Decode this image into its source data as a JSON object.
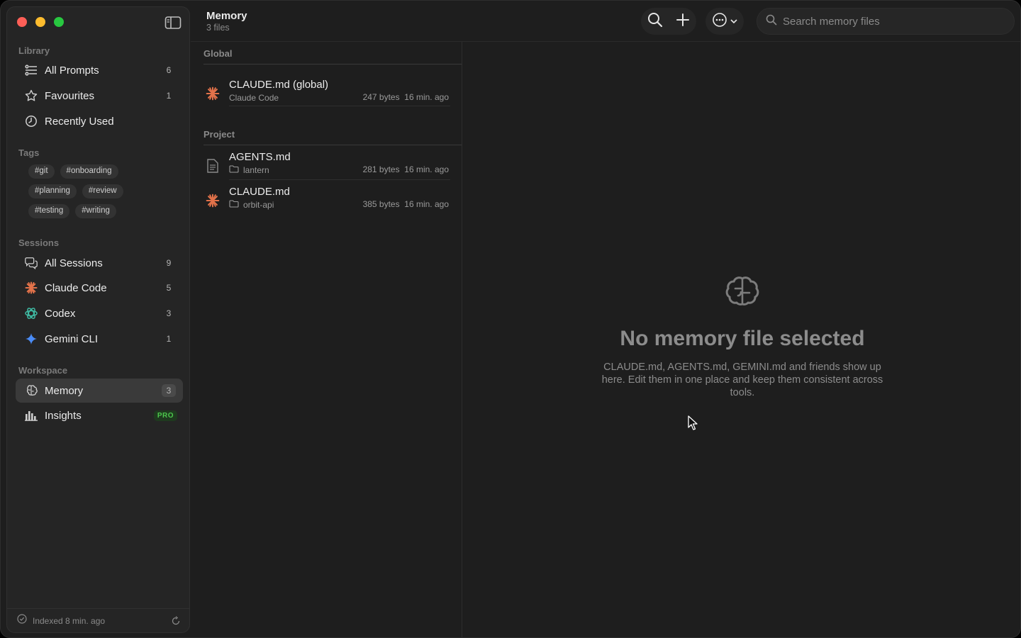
{
  "header": {
    "title": "Memory",
    "subtitle": "3 files",
    "search_placeholder": "Search memory files"
  },
  "sidebar": {
    "library_title": "Library",
    "library": [
      {
        "label": "All Prompts",
        "count": "6",
        "icon": "sliders-icon"
      },
      {
        "label": "Favourites",
        "count": "1",
        "icon": "star-icon"
      },
      {
        "label": "Recently Used",
        "count": "",
        "icon": "clock-icon"
      }
    ],
    "tags_title": "Tags",
    "tags": [
      "#git",
      "#onboarding",
      "#planning",
      "#review",
      "#testing",
      "#writing"
    ],
    "sessions_title": "Sessions",
    "sessions": [
      {
        "label": "All Sessions",
        "count": "9",
        "icon": "chat-bubbles-icon"
      },
      {
        "label": "Claude Code",
        "count": "5",
        "icon": "claude-icon"
      },
      {
        "label": "Codex",
        "count": "3",
        "icon": "openai-icon"
      },
      {
        "label": "Gemini CLI",
        "count": "1",
        "icon": "gemini-icon"
      }
    ],
    "workspace_title": "Workspace",
    "workspace": [
      {
        "label": "Memory",
        "count": "3",
        "icon": "brain-icon"
      },
      {
        "label": "Insights",
        "badge": "PRO",
        "icon": "bar-chart-icon"
      }
    ],
    "footer": "Indexed 8 min. ago"
  },
  "filelist": {
    "global_title": "Global",
    "global_files": [
      {
        "name": "CLAUDE.md (global)",
        "sub": "Claude Code",
        "size": "247 bytes",
        "time": "16 min. ago"
      }
    ],
    "project_title": "Project",
    "project_files": [
      {
        "name": "AGENTS.md",
        "sub": "lantern",
        "size": "281 bytes",
        "time": "16 min. ago"
      },
      {
        "name": "CLAUDE.md",
        "sub": "orbit-api",
        "size": "385 bytes",
        "time": "16 min. ago"
      }
    ]
  },
  "empty_state": {
    "title": "No memory file selected",
    "description": "CLAUDE.md, AGENTS.md, GEMINI.md and friends show up here. Edit them in one place and keep them consistent across tools."
  },
  "colors": {
    "claude": "#e2724a",
    "codex": "#3fb9a2",
    "gemini": "#4a8cf7",
    "pro": "#4cc74c"
  }
}
